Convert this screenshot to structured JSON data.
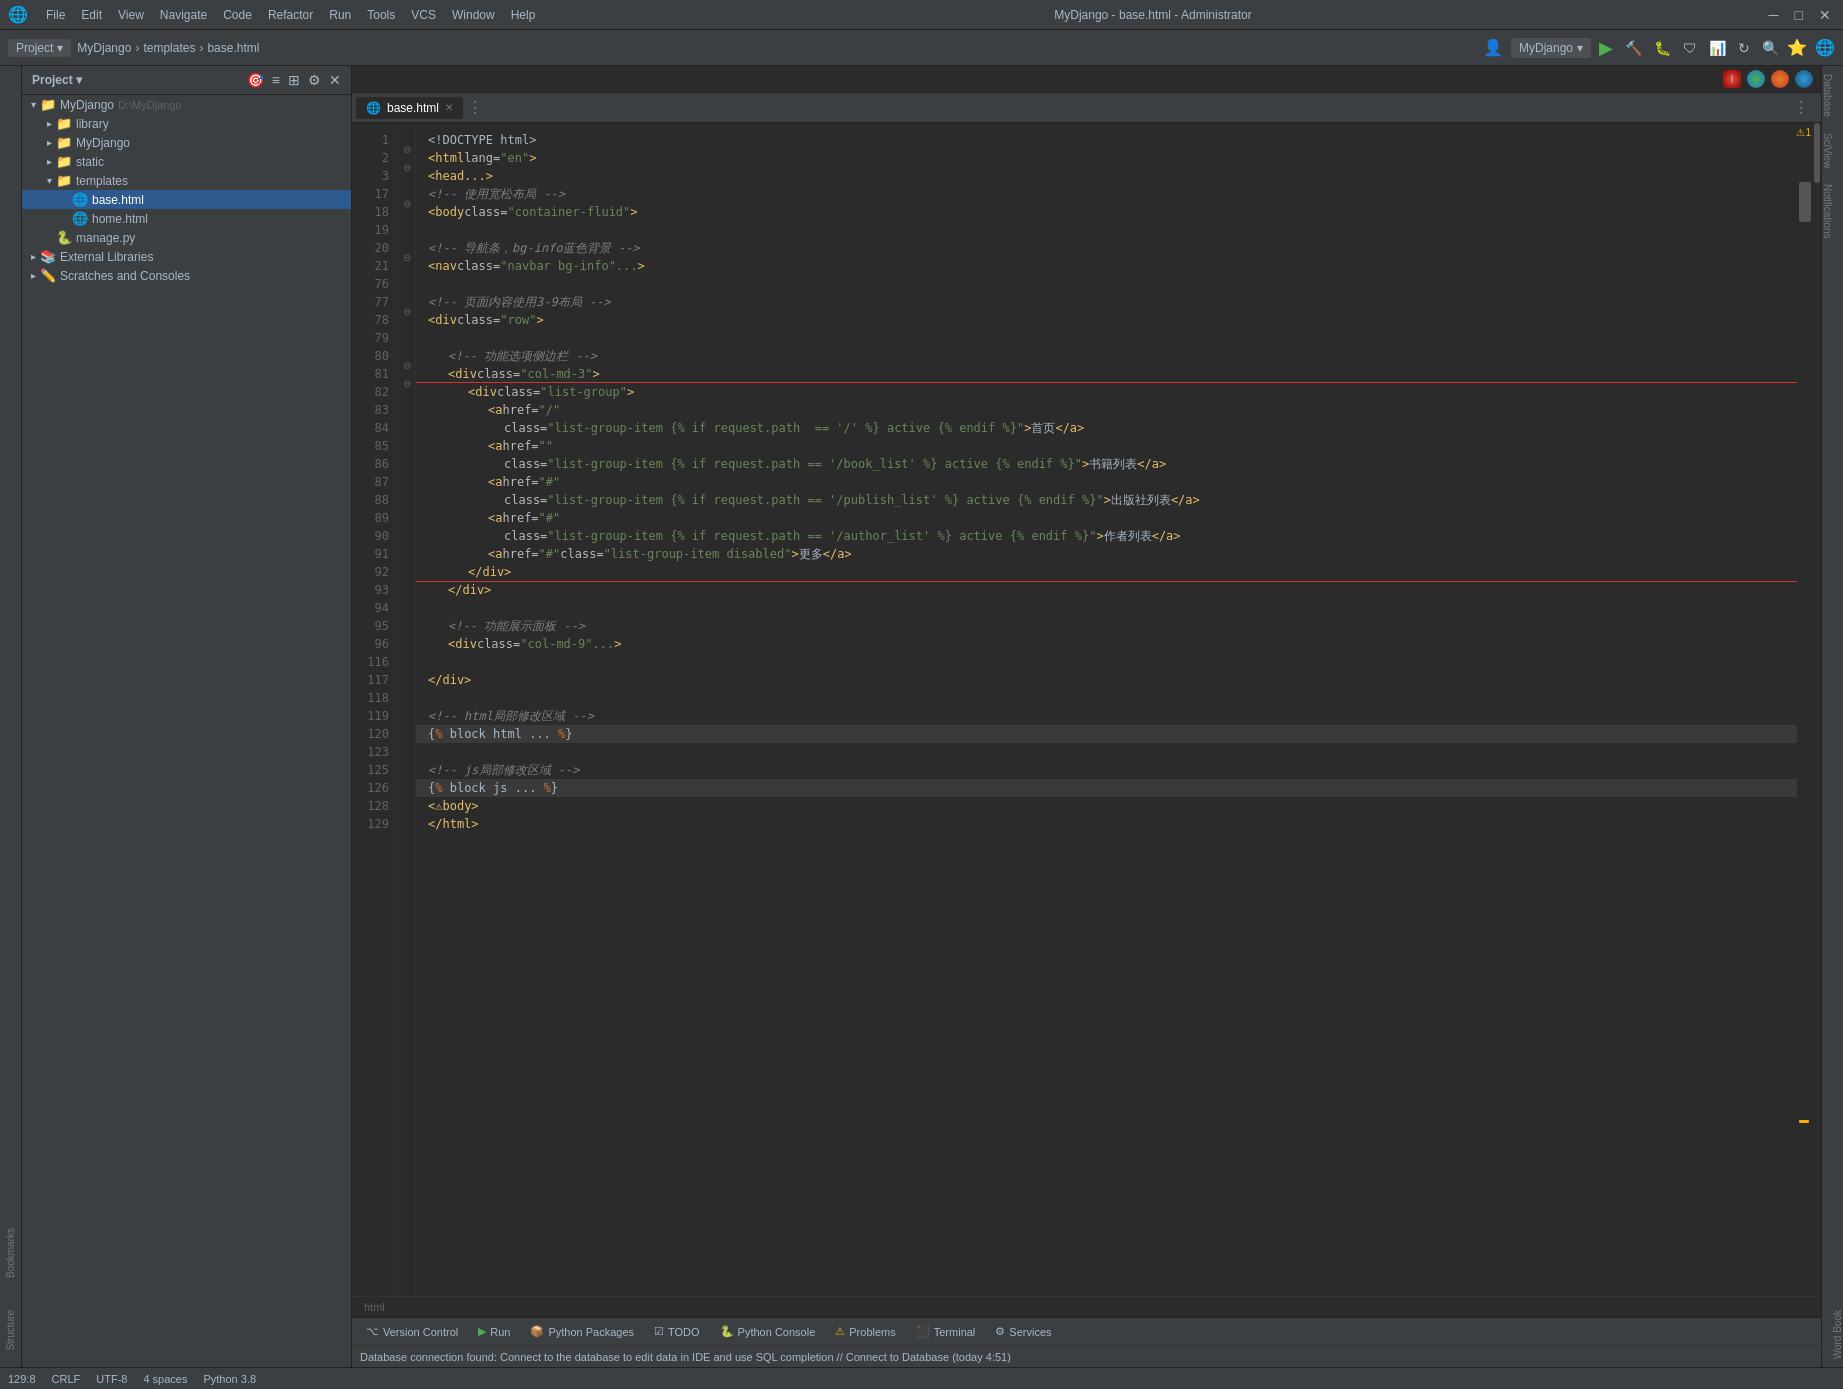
{
  "titlebar": {
    "logo": "🌐",
    "menus": [
      "File",
      "Edit",
      "View",
      "Navigate",
      "Code",
      "Refactor",
      "Run",
      "Tools",
      "VCS",
      "Window",
      "Help"
    ],
    "title": "MyDjango - base.html - Administrator",
    "controls": [
      "─",
      "□",
      "✕"
    ]
  },
  "toolbar": {
    "project_label": "Project",
    "breadcrumbs": [
      "MyDjango",
      "templates",
      "base.html"
    ],
    "run_config": "MyDjango",
    "run_icon": "▶",
    "settings_icon": "⚙",
    "more_icon": "⋮"
  },
  "sidebar": {
    "project_title": "Project",
    "tree": [
      {
        "id": "mydjango",
        "label": "MyDjango",
        "path": "D:\\MyDjango",
        "indent": 0,
        "type": "project",
        "arrow": "▾",
        "icon": "📁",
        "expanded": true
      },
      {
        "id": "library",
        "label": "library",
        "indent": 1,
        "type": "folder",
        "arrow": "▸",
        "icon": "📁",
        "expanded": false
      },
      {
        "id": "mydjango-pkg",
        "label": "MyDjango",
        "indent": 1,
        "type": "folder",
        "arrow": "▸",
        "icon": "📁",
        "expanded": false
      },
      {
        "id": "static",
        "label": "static",
        "indent": 1,
        "type": "folder",
        "arrow": "▸",
        "icon": "📁",
        "expanded": false
      },
      {
        "id": "templates",
        "label": "templates",
        "indent": 1,
        "type": "folder",
        "arrow": "▾",
        "icon": "📁",
        "expanded": true
      },
      {
        "id": "base-html",
        "label": "base.html",
        "indent": 2,
        "type": "file",
        "arrow": "",
        "icon": "🌐",
        "selected": true
      },
      {
        "id": "home-html",
        "label": "home.html",
        "indent": 2,
        "type": "file",
        "arrow": "",
        "icon": "🌐"
      },
      {
        "id": "manage-py",
        "label": "manage.py",
        "indent": 1,
        "type": "file",
        "arrow": "",
        "icon": "🐍"
      },
      {
        "id": "external-libs",
        "label": "External Libraries",
        "indent": 0,
        "type": "folder",
        "arrow": "▸",
        "icon": "📚",
        "expanded": false
      },
      {
        "id": "scratches",
        "label": "Scratches and Consoles",
        "indent": 0,
        "type": "folder",
        "arrow": "▸",
        "icon": "✏️",
        "expanded": false
      }
    ]
  },
  "editor": {
    "tab": "base.html",
    "lines": [
      {
        "num": 1,
        "content": "<!DOCTYPE html>",
        "type": "doctype"
      },
      {
        "num": 2,
        "content": "<html lang=\"en\">",
        "type": "tag"
      },
      {
        "num": 3,
        "content": "<head...>",
        "type": "tag"
      },
      {
        "num": 17,
        "content": "<!-- 使用宽松布局 -->",
        "type": "comment"
      },
      {
        "num": 18,
        "content": "<body class=\"container-fluid\">",
        "type": "tag"
      },
      {
        "num": 19,
        "content": "",
        "type": "empty"
      },
      {
        "num": 20,
        "content": "<!-- 导航条，bg-info蓝色背景 -->",
        "type": "comment"
      },
      {
        "num": 21,
        "content": "<nav class=\"navbar bg-info\"...>",
        "type": "tag"
      },
      {
        "num": 76,
        "content": "",
        "type": "empty"
      },
      {
        "num": 77,
        "content": "<!-- 页面内容使用3-9布局 -->",
        "type": "comment"
      },
      {
        "num": 78,
        "content": "<div class=\"row\">",
        "type": "tag"
      },
      {
        "num": 79,
        "content": "",
        "type": "empty"
      },
      {
        "num": 80,
        "content": "<!-- 功能选项侧边栏 -->",
        "type": "comment"
      },
      {
        "num": 81,
        "content": "<div class=\"col-md-3\">",
        "type": "tag"
      },
      {
        "num": 82,
        "content": "<div class=\"list-group\">",
        "type": "tag"
      },
      {
        "num": 83,
        "content": "<a href=\"/\"",
        "type": "code"
      },
      {
        "num": 84,
        "content": "class=\"list-group-item {% if request.path  == '/' %} active {% endif %}\">首页</a>",
        "type": "code"
      },
      {
        "num": 85,
        "content": "<a href=\"\"",
        "type": "code"
      },
      {
        "num": 86,
        "content": "class=\"list-group-item {% if request.path == '/book_list' %} active {% endif %}\">书籍列表</a>",
        "type": "code"
      },
      {
        "num": 87,
        "content": "<a href=\"#\"",
        "type": "code"
      },
      {
        "num": 88,
        "content": "class=\"list-group-item {% if request.path == '/publish_list' %} active {% endif %}\">出版社列表</a>",
        "type": "code"
      },
      {
        "num": 89,
        "content": "<a href=\"#\"",
        "type": "code"
      },
      {
        "num": 90,
        "content": "class=\"list-group-item {% if request.path == '/author_list' %} active {% endif %}\">作者列表</a>",
        "type": "code"
      },
      {
        "num": 91,
        "content": "<a href=\"#\" class=\"list-group-item disabled\">更多</a>",
        "type": "code"
      },
      {
        "num": 92,
        "content": "</div>",
        "type": "tag"
      },
      {
        "num": 93,
        "content": "</div>",
        "type": "tag"
      },
      {
        "num": 94,
        "content": "",
        "type": "empty"
      },
      {
        "num": 95,
        "content": "<!-- 功能展示面板 -->",
        "type": "comment"
      },
      {
        "num": 96,
        "content": "<div class=\"col-md-9\"...>",
        "type": "tag"
      },
      {
        "num": 116,
        "content": "",
        "type": "empty"
      },
      {
        "num": 117,
        "content": "</div>",
        "type": "tag"
      },
      {
        "num": 118,
        "content": "",
        "type": "empty"
      },
      {
        "num": 119,
        "content": "<!-- html局部修改区域 -->",
        "type": "comment"
      },
      {
        "num": 120,
        "content": "{% block html ... %}",
        "type": "django"
      },
      {
        "num": 123,
        "content": "",
        "type": "empty"
      },
      {
        "num": 125,
        "content": "<!-- js局部修改区域 -->",
        "type": "comment"
      },
      {
        "num": 126,
        "content": "{% block js ... %}",
        "type": "django"
      },
      {
        "num": 128,
        "content": "</body>",
        "type": "tag"
      },
      {
        "num": 129,
        "content": "</html>",
        "type": "tag"
      }
    ],
    "warning_count": 1,
    "position": "129:8",
    "encoding": "UTF-8",
    "line_separator": "CRLF",
    "indent": "4 spaces",
    "python_version": "Python 3.8",
    "file_type": "html"
  },
  "bottom_tabs": [
    {
      "label": "Version Control",
      "icon": "⌥"
    },
    {
      "label": "Run",
      "icon": "▶"
    },
    {
      "label": "Python Packages",
      "icon": "📦"
    },
    {
      "label": "TODO",
      "icon": "☑"
    },
    {
      "label": "Python Console",
      "icon": "🐍"
    },
    {
      "label": "Problems",
      "icon": "⚠"
    },
    {
      "label": "Terminal",
      "icon": "⬛"
    },
    {
      "label": "Services",
      "icon": "⚙"
    }
  ],
  "status_bar": {
    "message": "Database connection found: Connect to the database to edit data in IDE and use SQL completion // Connect to Database (today 4:51)"
  },
  "right_panels": [
    "Database",
    "SciView",
    "Notifications"
  ],
  "left_panels": [
    "Bookmarks",
    "Structure"
  ]
}
